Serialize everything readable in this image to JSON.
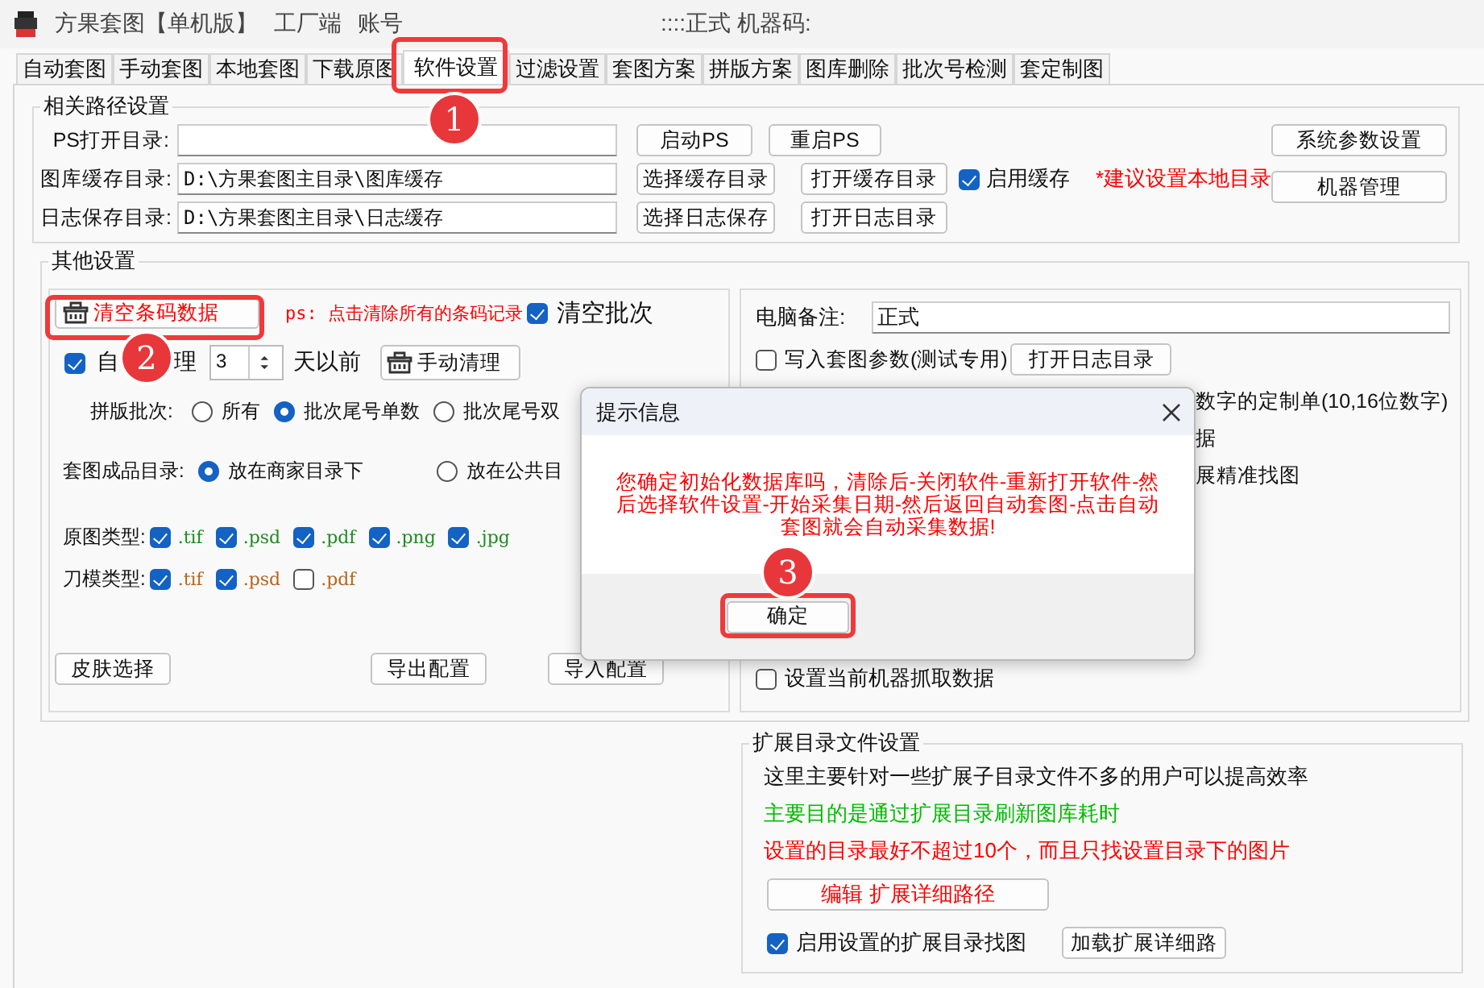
{
  "window": {
    "title": "方果套图【单机版】",
    "side": "工厂端",
    "account_label": "账号",
    "status": "::::正式 机器码:"
  },
  "tabs": [
    {
      "label": "自动套图",
      "selected": false
    },
    {
      "label": "手动套图",
      "selected": false
    },
    {
      "label": "本地套图",
      "selected": false
    },
    {
      "label": "下载原图",
      "selected": false
    },
    {
      "label": "软件设置",
      "selected": true
    },
    {
      "label": "过滤设置",
      "selected": false
    },
    {
      "label": "套图方案",
      "selected": false
    },
    {
      "label": "拼版方案",
      "selected": false
    },
    {
      "label": "图库删除",
      "selected": false
    },
    {
      "label": "批次号检测",
      "selected": false
    },
    {
      "label": "套定制图",
      "selected": false
    }
  ],
  "path_settings": {
    "title": "相关路径设置",
    "rows": [
      {
        "label": "PS打开目录:",
        "buttons": [
          "启动PS",
          "重启PS"
        ]
      },
      {
        "label": "图库缓存目录:",
        "value": "D:\\方果套图主目录\\图库缓存",
        "buttons": [
          "选择缓存目录",
          "打开缓存目录"
        ]
      },
      {
        "label": "日志保存目录:",
        "value": "D:\\方果套图主目录\\日志缓存",
        "buttons": [
          "选择日志保存",
          "打开日志目录"
        ]
      }
    ],
    "cache_checkbox": {
      "label": "启用缓存",
      "checked": true
    },
    "hint": "*建议设置本地目录",
    "side_buttons": [
      "系统参数设置",
      "机器管理"
    ]
  },
  "other_settings": {
    "title": "其他设置",
    "clear_barcode_button": "清空条码数据",
    "clear_hint": "ps: 点击清除所有的条码记录",
    "clear_batch": {
      "label": "清空批次",
      "checked": true
    },
    "auto_clean": {
      "label_parts": [
        "自",
        "理"
      ],
      "checked": true,
      "days": "3",
      "days_suffix": "天以前",
      "button": "手动清理"
    },
    "batch": {
      "label": "拼版批次:",
      "options": [
        {
          "label": "所有",
          "selected": false
        },
        {
          "label": "批次尾号单数",
          "selected": true
        },
        {
          "label": "批次尾号双",
          "selected": false
        }
      ]
    },
    "output_dir": {
      "label": "套图成品目录:",
      "options": [
        {
          "label": "放在商家目录下",
          "selected": true
        },
        {
          "label": "放在公共目",
          "selected": false
        }
      ]
    },
    "file_types": [
      {
        "label": "原图类型:",
        "color": "#1e8c1e",
        "items": [
          {
            "ext": ".tif",
            "checked": true
          },
          {
            "ext": ".psd",
            "checked": true
          },
          {
            "ext": ".pdf",
            "checked": true
          },
          {
            "ext": ".png",
            "checked": true
          },
          {
            "ext": ".jpg",
            "checked": true
          }
        ]
      },
      {
        "label": "刀模类型:",
        "color": "#b5651d",
        "items": [
          {
            "ext": ".tif",
            "checked": true
          },
          {
            "ext": ".psd",
            "checked": true
          },
          {
            "ext": ".pdf",
            "checked": false
          }
        ]
      }
    ],
    "buttons": [
      "皮肤选择",
      "导出配置",
      "导入配置"
    ]
  },
  "machine": {
    "note_label": "电脑备注:",
    "note_value": "正式",
    "write_params": {
      "label": "写入套图参数(测试专用)",
      "checked": false
    },
    "open_log_button": "打开日志目录",
    "partial_lines": [
      "数字的定制单(10,16位数字)",
      "据",
      "展精准找图"
    ],
    "grab_data": {
      "label": "设置当前机器抓取数据",
      "checked": false
    }
  },
  "extension": {
    "title": "扩展目录文件设置",
    "lines": [
      {
        "text": "这里主要针对一些扩展子目录文件不多的用户可以提高效率",
        "kind": "normal"
      },
      {
        "text": "主要目的是通过扩展目录刷新图库耗时",
        "kind": "good"
      },
      {
        "text": "设置的目录最好不超过10个，而且只找设置目录下的图片",
        "kind": "warning"
      }
    ],
    "edit_button": "编辑 扩展详细路径",
    "enable": {
      "label": "启用设置的扩展目录找图",
      "checked": true
    },
    "load_button": "加载扩展详细路"
  },
  "dialog": {
    "title": "提示信息",
    "message": "您确定初始化数据库吗，清除后-关闭软件-重新打开软件-然后选择软件设置-开始采集日期-然后返回自动套图-点击自动套图就会自动采集数据!",
    "ok_button": "确定"
  },
  "annotations": [
    {
      "label": "1"
    },
    {
      "label": "2"
    },
    {
      "label": "3"
    }
  ]
}
